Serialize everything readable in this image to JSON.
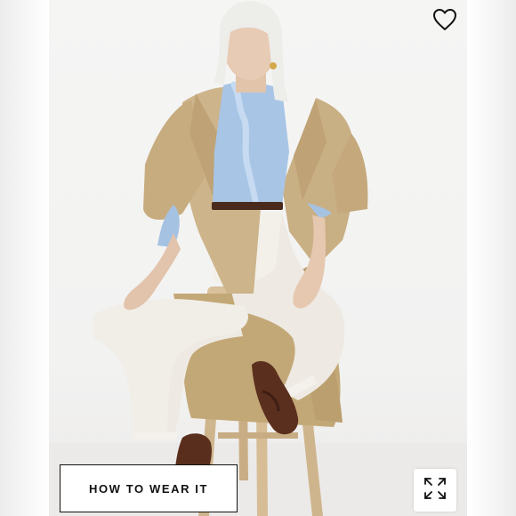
{
  "product_image": {
    "alt_icon": "model-photo",
    "favorite_icon": "heart-outline-icon",
    "expand_icon": "expand-arrows-icon"
  },
  "how_to_wear": {
    "label": "HOW TO WEAR IT"
  },
  "colors": {
    "trench": "#cdb48c",
    "shirt": "#a9c6e6",
    "jeans": "#efece6",
    "stool": "#d8c09a",
    "loafers": "#5a2e1c"
  }
}
